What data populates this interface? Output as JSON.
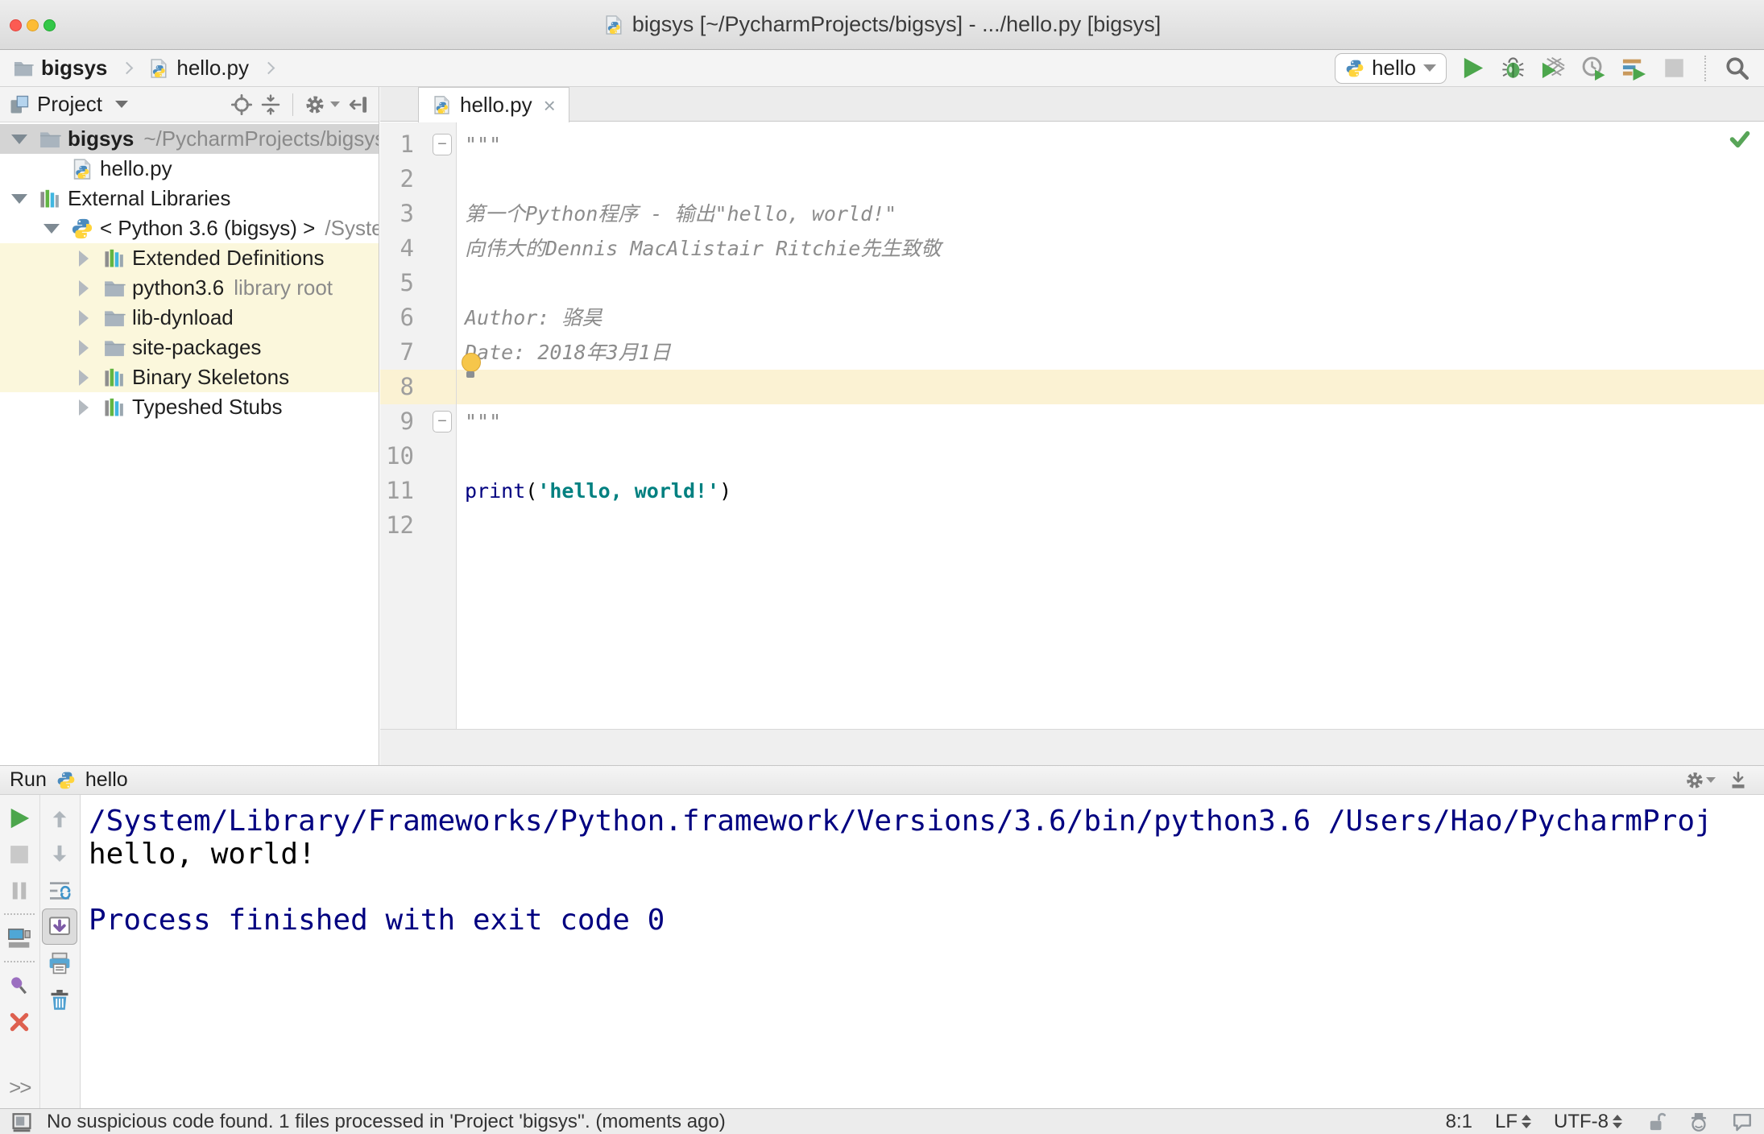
{
  "window": {
    "title": "bigsys [~/PycharmProjects/bigsys] - .../hello.py [bigsys]"
  },
  "navbar": {
    "breadcrumbs": [
      {
        "label": "bigsys",
        "bold": true,
        "icon": "folder"
      },
      {
        "label": "hello.py",
        "bold": false,
        "icon": "python-file"
      }
    ],
    "run_config": {
      "icon": "python",
      "label": "hello"
    },
    "actions": [
      "run",
      "debug",
      "run-with-coverage",
      "profile",
      "concurrency-diagram",
      "stop",
      "search-everywhere"
    ]
  },
  "project_panel": {
    "title": "Project",
    "toolbar": [
      "locate",
      "collapse-all",
      "settings",
      "hide-panel"
    ],
    "tree": [
      {
        "depth": 0,
        "arrow": "expanded",
        "icon": "folder",
        "label": "bigsys",
        "bold": true,
        "hint": "~/PycharmProjects/bigsys",
        "state": "selected"
      },
      {
        "depth": 2,
        "arrow": "none",
        "icon": "python-file",
        "label": "hello.py"
      },
      {
        "depth": 0,
        "arrow": "expanded",
        "icon": "library",
        "label": "External Libraries"
      },
      {
        "depth": 1,
        "arrow": "expanded",
        "icon": "python",
        "label": "< Python 3.6 (bigsys) >",
        "hint": "/System"
      },
      {
        "depth": 2,
        "arrow": "collapsed",
        "icon": "library",
        "label": "Extended Definitions",
        "state": "highlighted"
      },
      {
        "depth": 2,
        "arrow": "collapsed",
        "icon": "folder",
        "label": "python3.6",
        "hint": "library root",
        "state": "highlighted"
      },
      {
        "depth": 2,
        "arrow": "collapsed",
        "icon": "folder",
        "label": "lib-dynload",
        "state": "highlighted"
      },
      {
        "depth": 2,
        "arrow": "collapsed",
        "icon": "folder",
        "label": "site-packages",
        "state": "highlighted"
      },
      {
        "depth": 2,
        "arrow": "collapsed",
        "icon": "library",
        "label": "Binary Skeletons",
        "state": "highlighted"
      },
      {
        "depth": 2,
        "arrow": "collapsed",
        "icon": "library",
        "label": "Typeshed Stubs"
      }
    ]
  },
  "editor": {
    "tab": {
      "label": "hello.py",
      "close": "×"
    },
    "lines": [
      {
        "num": 1,
        "tokens": [
          {
            "t": "\"\"\"",
            "c": "doc"
          }
        ],
        "fold": "top"
      },
      {
        "num": 2,
        "tokens": []
      },
      {
        "num": 3,
        "tokens": [
          {
            "t": "第一个Python程序 - 输出\"hello, world!\"",
            "c": "doc"
          }
        ]
      },
      {
        "num": 4,
        "tokens": [
          {
            "t": "向伟大的Dennis MacAlistair Ritchie先生致敬",
            "c": "doc"
          }
        ]
      },
      {
        "num": 5,
        "tokens": []
      },
      {
        "num": 6,
        "tokens": [
          {
            "t": "Author: 骆昊",
            "c": "doc"
          }
        ]
      },
      {
        "num": 7,
        "tokens": [
          {
            "t": "Date: 2018年3月1日",
            "c": "doc"
          }
        ],
        "bulb": true
      },
      {
        "num": 8,
        "tokens": [],
        "caret": true
      },
      {
        "num": 9,
        "tokens": [
          {
            "t": "\"\"\"",
            "c": "doc"
          }
        ],
        "fold": "bottom"
      },
      {
        "num": 10,
        "tokens": []
      },
      {
        "num": 11,
        "tokens": [
          {
            "t": "print",
            "c": "kw"
          },
          {
            "t": "(",
            "c": "plain"
          },
          {
            "t": "'hello, world!'",
            "c": "str"
          },
          {
            "t": ")",
            "c": "plain"
          }
        ]
      },
      {
        "num": 12,
        "tokens": []
      }
    ]
  },
  "run_panel": {
    "title": "Run",
    "config": "hello",
    "more_label": ">>",
    "console": [
      {
        "text": "/System/Library/Frameworks/Python.framework/Versions/3.6/bin/python3.6 /Users/Hao/PycharmProj",
        "style": "system"
      },
      {
        "text": "hello, world!",
        "style": "stdout"
      },
      {
        "text": "",
        "style": "stdout"
      },
      {
        "text": "Process finished with exit code 0",
        "style": "system"
      }
    ]
  },
  "status_bar": {
    "message": "No suspicious code found. 1 files processed in 'Project 'bigsys''. (moments ago)",
    "caret_position": "8:1",
    "line_separator": "LF",
    "encoding": "UTF-8"
  },
  "colors": {
    "run_green": "#4CA64C",
    "selection_gray": "#D4D4D4",
    "library_row_highlight": "#FBF7DC",
    "caret_line": "#FBF2D3",
    "keyword": "#000080",
    "string": "#008080",
    "doc_comment": "#8C8C8C",
    "console_system": "#000080"
  }
}
